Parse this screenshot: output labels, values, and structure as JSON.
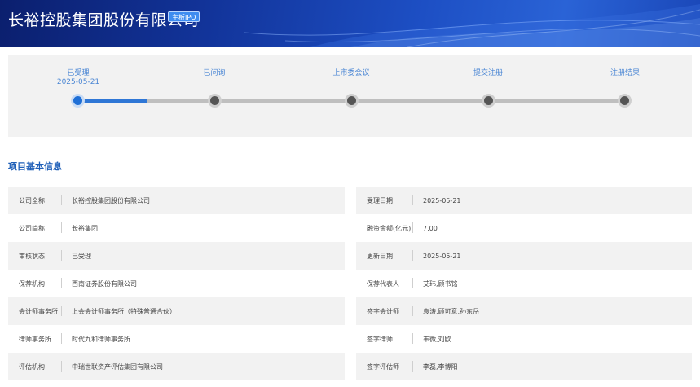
{
  "header": {
    "title": "长裕控股集团股份有限公司",
    "badge": "主板IPO"
  },
  "progress": {
    "steps": [
      {
        "label": "已受理",
        "date": "2025-05-21",
        "active": true
      },
      {
        "label": "已问询",
        "date": "",
        "active": false
      },
      {
        "label": "上市委会议",
        "date": "",
        "active": false
      },
      {
        "label": "提交注册",
        "date": "",
        "active": false
      },
      {
        "label": "注册结果",
        "date": "",
        "active": false
      }
    ]
  },
  "section": {
    "title": "项目基本信息"
  },
  "info": {
    "left": [
      {
        "key": "公司全称",
        "value": "长裕控股集团股份有限公司"
      },
      {
        "key": "公司简称",
        "value": "长裕集团"
      },
      {
        "key": "审核状态",
        "value": "已受理"
      },
      {
        "key": "保荐机构",
        "value": "西南证券股份有限公司"
      },
      {
        "key": "会计师事务所",
        "value": "上会会计师事务所（特殊普通合伙）"
      },
      {
        "key": "律师事务所",
        "value": "时代九和律师事务所"
      },
      {
        "key": "评估机构",
        "value": "中瑞世联资产评估集团有限公司"
      }
    ],
    "right": [
      {
        "key": "受理日期",
        "value": "2025-05-21"
      },
      {
        "key": "融资金额(亿元)",
        "value": "7.00"
      },
      {
        "key": "更新日期",
        "value": "2025-05-21"
      },
      {
        "key": "保荐代表人",
        "value": "艾玮,顾书铭"
      },
      {
        "key": "签字会计师",
        "value": "袁涛,顾可意,孙东岳"
      },
      {
        "key": "签字律师",
        "value": "韦微,刘欧"
      },
      {
        "key": "签字评估师",
        "value": "李磊,李博阳"
      }
    ]
  },
  "colors": {
    "accent": "#1f6fd6",
    "step_label": "#4a86d4",
    "section_title": "#1f5fb8",
    "banner_dark": "#0b1f6e"
  }
}
